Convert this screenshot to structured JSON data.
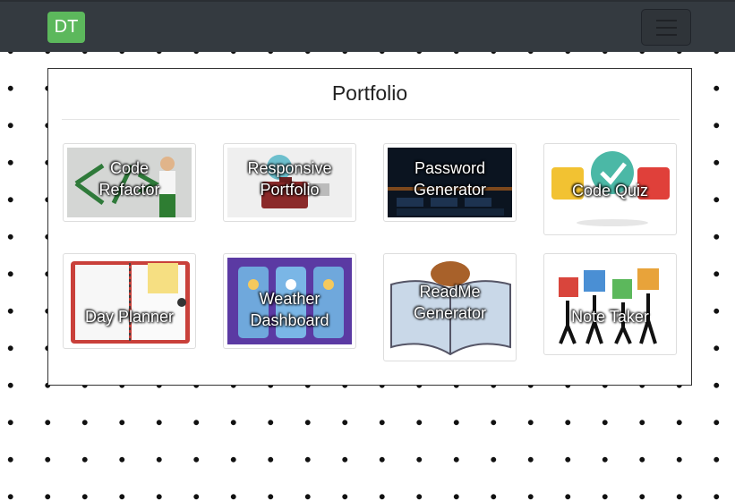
{
  "navbar": {
    "brand": "DT",
    "menu_icon": "hamburger-icon"
  },
  "portfolio": {
    "title": "Portfolio",
    "projects": [
      {
        "line1": "Code",
        "line2": "Refactor"
      },
      {
        "line1": "Responsive",
        "line2": "Portfolio"
      },
      {
        "line1": "Password",
        "line2": "Generator"
      },
      {
        "line1": "Code Quiz"
      },
      {
        "line1": "Day Planner"
      },
      {
        "line1": "Weather",
        "line2": "Dashboard"
      },
      {
        "line1": "ReadMe",
        "line2": "Generator"
      },
      {
        "line1": "Note Taker"
      }
    ]
  },
  "colors": {
    "navbar_bg": "#343a40",
    "brand_bg": "#5cb85c"
  }
}
